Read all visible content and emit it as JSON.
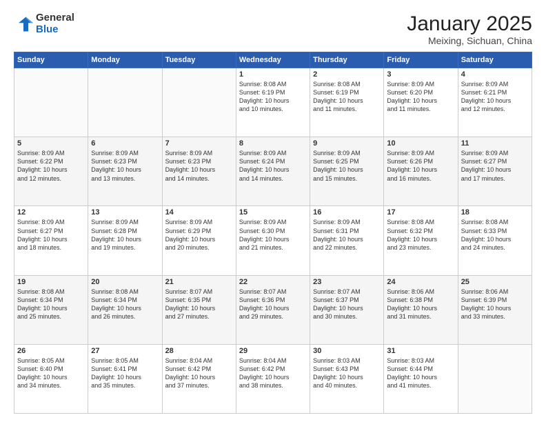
{
  "header": {
    "logo_general": "General",
    "logo_blue": "Blue",
    "month_title": "January 2025",
    "subtitle": "Meixing, Sichuan, China"
  },
  "weekdays": [
    "Sunday",
    "Monday",
    "Tuesday",
    "Wednesday",
    "Thursday",
    "Friday",
    "Saturday"
  ],
  "weeks": [
    [
      {
        "day": "",
        "text": ""
      },
      {
        "day": "",
        "text": ""
      },
      {
        "day": "",
        "text": ""
      },
      {
        "day": "1",
        "text": "Sunrise: 8:08 AM\nSunset: 6:19 PM\nDaylight: 10 hours\nand 10 minutes."
      },
      {
        "day": "2",
        "text": "Sunrise: 8:08 AM\nSunset: 6:19 PM\nDaylight: 10 hours\nand 11 minutes."
      },
      {
        "day": "3",
        "text": "Sunrise: 8:09 AM\nSunset: 6:20 PM\nDaylight: 10 hours\nand 11 minutes."
      },
      {
        "day": "4",
        "text": "Sunrise: 8:09 AM\nSunset: 6:21 PM\nDaylight: 10 hours\nand 12 minutes."
      }
    ],
    [
      {
        "day": "5",
        "text": "Sunrise: 8:09 AM\nSunset: 6:22 PM\nDaylight: 10 hours\nand 12 minutes."
      },
      {
        "day": "6",
        "text": "Sunrise: 8:09 AM\nSunset: 6:23 PM\nDaylight: 10 hours\nand 13 minutes."
      },
      {
        "day": "7",
        "text": "Sunrise: 8:09 AM\nSunset: 6:23 PM\nDaylight: 10 hours\nand 14 minutes."
      },
      {
        "day": "8",
        "text": "Sunrise: 8:09 AM\nSunset: 6:24 PM\nDaylight: 10 hours\nand 14 minutes."
      },
      {
        "day": "9",
        "text": "Sunrise: 8:09 AM\nSunset: 6:25 PM\nDaylight: 10 hours\nand 15 minutes."
      },
      {
        "day": "10",
        "text": "Sunrise: 8:09 AM\nSunset: 6:26 PM\nDaylight: 10 hours\nand 16 minutes."
      },
      {
        "day": "11",
        "text": "Sunrise: 8:09 AM\nSunset: 6:27 PM\nDaylight: 10 hours\nand 17 minutes."
      }
    ],
    [
      {
        "day": "12",
        "text": "Sunrise: 8:09 AM\nSunset: 6:27 PM\nDaylight: 10 hours\nand 18 minutes."
      },
      {
        "day": "13",
        "text": "Sunrise: 8:09 AM\nSunset: 6:28 PM\nDaylight: 10 hours\nand 19 minutes."
      },
      {
        "day": "14",
        "text": "Sunrise: 8:09 AM\nSunset: 6:29 PM\nDaylight: 10 hours\nand 20 minutes."
      },
      {
        "day": "15",
        "text": "Sunrise: 8:09 AM\nSunset: 6:30 PM\nDaylight: 10 hours\nand 21 minutes."
      },
      {
        "day": "16",
        "text": "Sunrise: 8:09 AM\nSunset: 6:31 PM\nDaylight: 10 hours\nand 22 minutes."
      },
      {
        "day": "17",
        "text": "Sunrise: 8:08 AM\nSunset: 6:32 PM\nDaylight: 10 hours\nand 23 minutes."
      },
      {
        "day": "18",
        "text": "Sunrise: 8:08 AM\nSunset: 6:33 PM\nDaylight: 10 hours\nand 24 minutes."
      }
    ],
    [
      {
        "day": "19",
        "text": "Sunrise: 8:08 AM\nSunset: 6:34 PM\nDaylight: 10 hours\nand 25 minutes."
      },
      {
        "day": "20",
        "text": "Sunrise: 8:08 AM\nSunset: 6:34 PM\nDaylight: 10 hours\nand 26 minutes."
      },
      {
        "day": "21",
        "text": "Sunrise: 8:07 AM\nSunset: 6:35 PM\nDaylight: 10 hours\nand 27 minutes."
      },
      {
        "day": "22",
        "text": "Sunrise: 8:07 AM\nSunset: 6:36 PM\nDaylight: 10 hours\nand 29 minutes."
      },
      {
        "day": "23",
        "text": "Sunrise: 8:07 AM\nSunset: 6:37 PM\nDaylight: 10 hours\nand 30 minutes."
      },
      {
        "day": "24",
        "text": "Sunrise: 8:06 AM\nSunset: 6:38 PM\nDaylight: 10 hours\nand 31 minutes."
      },
      {
        "day": "25",
        "text": "Sunrise: 8:06 AM\nSunset: 6:39 PM\nDaylight: 10 hours\nand 33 minutes."
      }
    ],
    [
      {
        "day": "26",
        "text": "Sunrise: 8:05 AM\nSunset: 6:40 PM\nDaylight: 10 hours\nand 34 minutes."
      },
      {
        "day": "27",
        "text": "Sunrise: 8:05 AM\nSunset: 6:41 PM\nDaylight: 10 hours\nand 35 minutes."
      },
      {
        "day": "28",
        "text": "Sunrise: 8:04 AM\nSunset: 6:42 PM\nDaylight: 10 hours\nand 37 minutes."
      },
      {
        "day": "29",
        "text": "Sunrise: 8:04 AM\nSunset: 6:42 PM\nDaylight: 10 hours\nand 38 minutes."
      },
      {
        "day": "30",
        "text": "Sunrise: 8:03 AM\nSunset: 6:43 PM\nDaylight: 10 hours\nand 40 minutes."
      },
      {
        "day": "31",
        "text": "Sunrise: 8:03 AM\nSunset: 6:44 PM\nDaylight: 10 hours\nand 41 minutes."
      },
      {
        "day": "",
        "text": ""
      }
    ]
  ]
}
